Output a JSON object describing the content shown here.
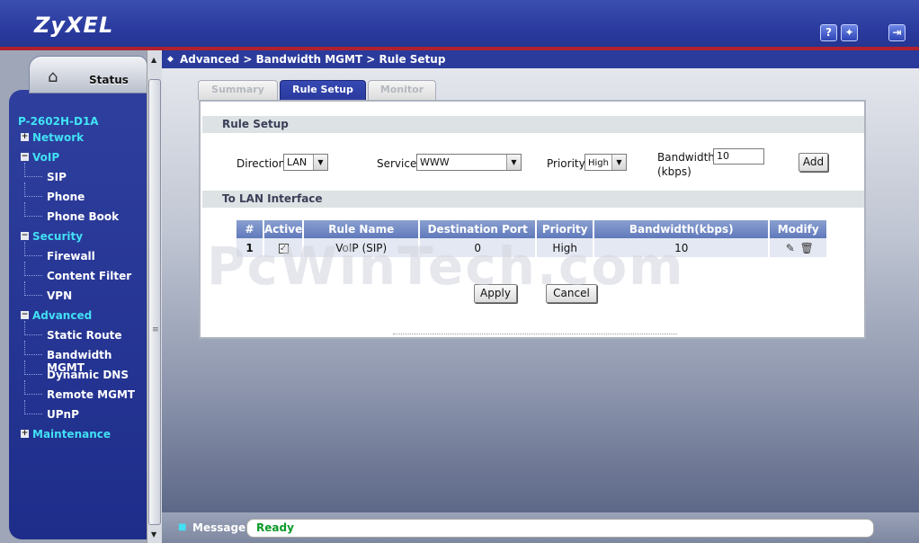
{
  "header": {
    "logo": "ZyXEL",
    "help_icon_label": "?",
    "wizard_icon_label": "✦",
    "logout_icon_label": "⇥"
  },
  "sidebar": {
    "status_label": "Status",
    "model": "P-2602H-D1A",
    "items": [
      {
        "label": "Network",
        "level": "top",
        "expander": "+"
      },
      {
        "label": "VoIP",
        "level": "top",
        "expander": "−"
      },
      {
        "label": "SIP",
        "level": "sub"
      },
      {
        "label": "Phone",
        "level": "sub"
      },
      {
        "label": "Phone Book",
        "level": "sub"
      },
      {
        "label": "Security",
        "level": "top",
        "expander": "−"
      },
      {
        "label": "Firewall",
        "level": "sub"
      },
      {
        "label": "Content Filter",
        "level": "sub"
      },
      {
        "label": "VPN",
        "level": "sub"
      },
      {
        "label": "Advanced",
        "level": "top",
        "expander": "−"
      },
      {
        "label": "Static Route",
        "level": "sub"
      },
      {
        "label": "Bandwidth MGMT",
        "level": "sub"
      },
      {
        "label": "Dynamic DNS",
        "level": "sub"
      },
      {
        "label": "Remote MGMT",
        "level": "sub"
      },
      {
        "label": "UPnP",
        "level": "sub"
      },
      {
        "label": "Maintenance",
        "level": "top",
        "expander": "+"
      }
    ]
  },
  "breadcrumb": "Advanced > Bandwidth MGMT > Rule Setup",
  "tabs": [
    {
      "label": "Summary",
      "active": false
    },
    {
      "label": "Rule Setup",
      "active": true
    },
    {
      "label": "Monitor",
      "active": false
    }
  ],
  "rule_setup": {
    "section_title": "Rule Setup",
    "direction_label": "Direction",
    "direction_value": "LAN",
    "service_label": "Service",
    "service_value": "WWW",
    "priority_label": "Priority",
    "priority_value": "High",
    "bandwidth_label_1": "Bandwidth",
    "bandwidth_label_2": "(kbps)",
    "bandwidth_value": "10",
    "add_label": "Add"
  },
  "lan_interface": {
    "section_title": "To LAN Interface",
    "columns": [
      "#",
      "Active",
      "Rule Name",
      "Destination Port",
      "Priority",
      "Bandwidth(kbps)",
      "Modify"
    ],
    "rows": [
      {
        "index": "1",
        "active": true,
        "rule_name": "VoIP (SIP)",
        "destination_port": "0",
        "priority": "High",
        "bandwidth": "10"
      }
    ]
  },
  "buttons": {
    "apply": "Apply",
    "cancel": "Cancel"
  },
  "watermark": "PcWinTech.com",
  "message_bar": {
    "label": "Message",
    "value": "Ready"
  },
  "colors": {
    "brand_blue": "#2a3a9e",
    "accent_cyan": "#41e0f4",
    "header_red": "#b0212f",
    "ready_green": "#0a9a2a"
  }
}
